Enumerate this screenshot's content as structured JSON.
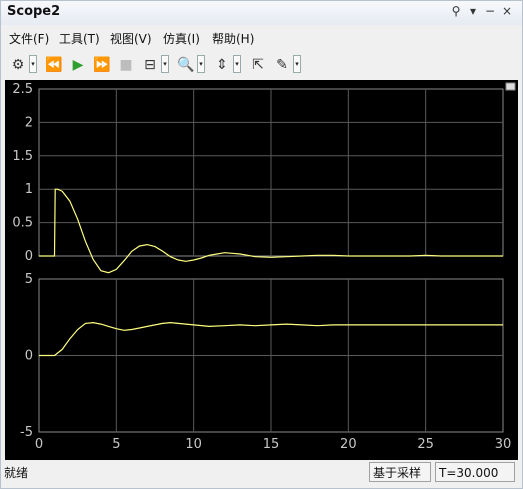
{
  "window": {
    "title": "Scope2"
  },
  "title_controls": [
    "⚲",
    "▾",
    "×"
  ],
  "menu": [
    "文件(F)",
    "工具(T)",
    "视图(V)",
    "仿真(I)",
    "帮助(H)"
  ],
  "toolbar_icons": [
    {
      "name": "settings-icon",
      "glyph": "⚙",
      "dropdown": true
    },
    {
      "name": "step-back-icon",
      "glyph": "⏪",
      "dropdown": false
    },
    {
      "name": "run-icon",
      "glyph": "▶",
      "dropdown": false,
      "color": "#2e9e2e"
    },
    {
      "name": "step-forward-icon",
      "glyph": "⏩",
      "dropdown": false
    },
    {
      "name": "stop-icon",
      "glyph": "■",
      "dropdown": false,
      "color": "#bdbdbd"
    },
    {
      "name": "highlight-icon",
      "glyph": "⊟",
      "dropdown": true
    },
    {
      "name": "zoom-icon",
      "glyph": "🔍",
      "dropdown": true
    },
    {
      "name": "autoscale-icon",
      "glyph": "⇕",
      "dropdown": true
    },
    {
      "name": "cursor-measure-icon",
      "glyph": "⇱",
      "dropdown": false
    },
    {
      "name": "style-icon",
      "glyph": "✎",
      "dropdown": true
    }
  ],
  "status": {
    "text": "就绪",
    "sample_mode": "基于采样",
    "time": "T=30.000"
  },
  "colors": {
    "plot_bg": "#000000",
    "axes_bg": "#000000",
    "grid": "#5a5a5a",
    "axis_text": "#c8c8c8",
    "signal": "#ffff80"
  },
  "chart_data": [
    {
      "type": "line",
      "xlim": [
        0,
        30
      ],
      "ylim": [
        0,
        2.5
      ],
      "yticks": [
        "0",
        "0.5",
        "1",
        "1.5",
        "2",
        "2.5"
      ],
      "xticks_visible": false,
      "grid": true,
      "series": [
        {
          "x": [
            0,
            1,
            1.05,
            1.2,
            1.5,
            2,
            2.5,
            3,
            3.5,
            4,
            4.5,
            5,
            5.5,
            6,
            6.5,
            7,
            7.5,
            8,
            8.5,
            9,
            9.5,
            10,
            10.5,
            11,
            11.5,
            12,
            12.5,
            13,
            13.5,
            14,
            15,
            16,
            17,
            18,
            19,
            20,
            21,
            22,
            23,
            24,
            25,
            26,
            27,
            28,
            29,
            30
          ],
          "y": [
            0,
            0,
            1.0,
            1.0,
            0.97,
            0.82,
            0.55,
            0.22,
            -0.05,
            -0.22,
            -0.25,
            -0.2,
            -0.07,
            0.07,
            0.15,
            0.17,
            0.14,
            0.07,
            -0.01,
            -0.06,
            -0.08,
            -0.06,
            -0.03,
            0.01,
            0.03,
            0.05,
            0.04,
            0.03,
            0.01,
            -0.01,
            -0.02,
            -0.01,
            0,
            0.01,
            0.01,
            0,
            0,
            0,
            0,
            0,
            0.01,
            0,
            0,
            0,
            0,
            0
          ]
        }
      ]
    },
    {
      "type": "line",
      "xlim": [
        0,
        30
      ],
      "ylim": [
        -5,
        5
      ],
      "yticks": [
        "-5",
        "0",
        "5"
      ],
      "xticks": [
        "0",
        "5",
        "10",
        "15",
        "20",
        "25",
        "30"
      ],
      "grid": true,
      "series": [
        {
          "x": [
            0,
            1,
            1.5,
            2,
            2.5,
            3,
            3.5,
            4,
            4.5,
            5,
            5.5,
            6,
            6.5,
            7,
            7.5,
            8,
            8.5,
            9,
            9.5,
            10,
            11,
            12,
            13,
            14,
            15,
            16,
            17,
            18,
            19,
            20,
            22,
            24,
            26,
            28,
            30
          ],
          "y": [
            0,
            0,
            0.4,
            1.1,
            1.7,
            2.1,
            2.15,
            2.05,
            1.9,
            1.75,
            1.65,
            1.7,
            1.8,
            1.9,
            2.0,
            2.1,
            2.15,
            2.1,
            2.05,
            2.0,
            1.9,
            1.95,
            2.0,
            1.95,
            2.0,
            2.05,
            2.0,
            1.95,
            2.0,
            2.0,
            2.0,
            2.0,
            2.0,
            2.0,
            2.0
          ]
        }
      ]
    }
  ]
}
